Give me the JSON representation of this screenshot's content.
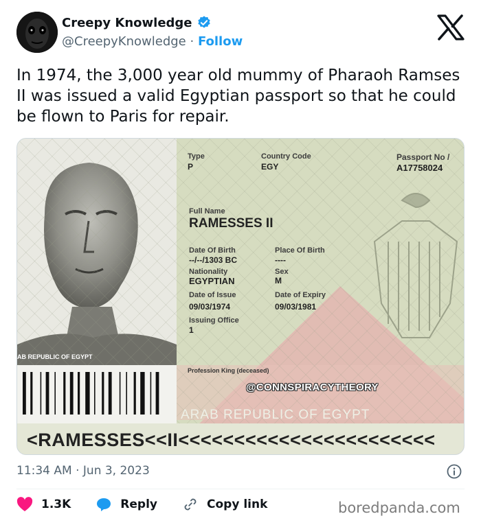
{
  "header": {
    "display_name": "Creepy Knowledge",
    "handle": "@CreepyKnowledge",
    "separator": "·",
    "follow_label": "Follow"
  },
  "tweet": {
    "text": "In 1974, the 3,000 year old mummy of Pharaoh Ramses II was issued a valid Egyptian passport so that he could be flown to Paris for repair."
  },
  "passport": {
    "type_label": "Type",
    "type_value": "P",
    "country_label": "Country Code",
    "country_value": "EGY",
    "passport_no_label": "Passport No /",
    "passport_no_value": "A17758024",
    "full_name_label": "Full Name",
    "full_name_value": "RAMESSES II",
    "dob_label": "Date Of Birth",
    "dob_value": "--/--/1303 BC",
    "pob_label": "Place Of Birth",
    "pob_value": "----",
    "nationality_label": "Nationality",
    "nationality_value": "EGYPTIAN",
    "sex_label": "Sex",
    "sex_value": "M",
    "issue_label": "Date of Issue",
    "issue_value": "09/03/1974",
    "expiry_label": "Date of Expiry",
    "expiry_value": "09/03/1981",
    "office_label": "Issuing Office",
    "office_value": "1",
    "profession_label": "Profession",
    "profession_value": "King (deceased)",
    "watermark": "@CONNSPIRACYTHEORY",
    "country_banner": "ARAB REPUBLIC OF EGYPT",
    "side_text": "AB REPUBLIC OF EGYPT",
    "mrz": "<RAMESSES<<II<<<<<<<<<<<<<<<<<<<<<<<"
  },
  "footer": {
    "timestamp": "11:34 AM · Jun 3, 2023",
    "likes": "1.3K",
    "reply_label": "Reply",
    "copy_link_label": "Copy link",
    "brand": "boredpanda.com"
  },
  "colors": {
    "accent": "#1d9bf0",
    "like": "#f91880",
    "muted": "#536471"
  }
}
